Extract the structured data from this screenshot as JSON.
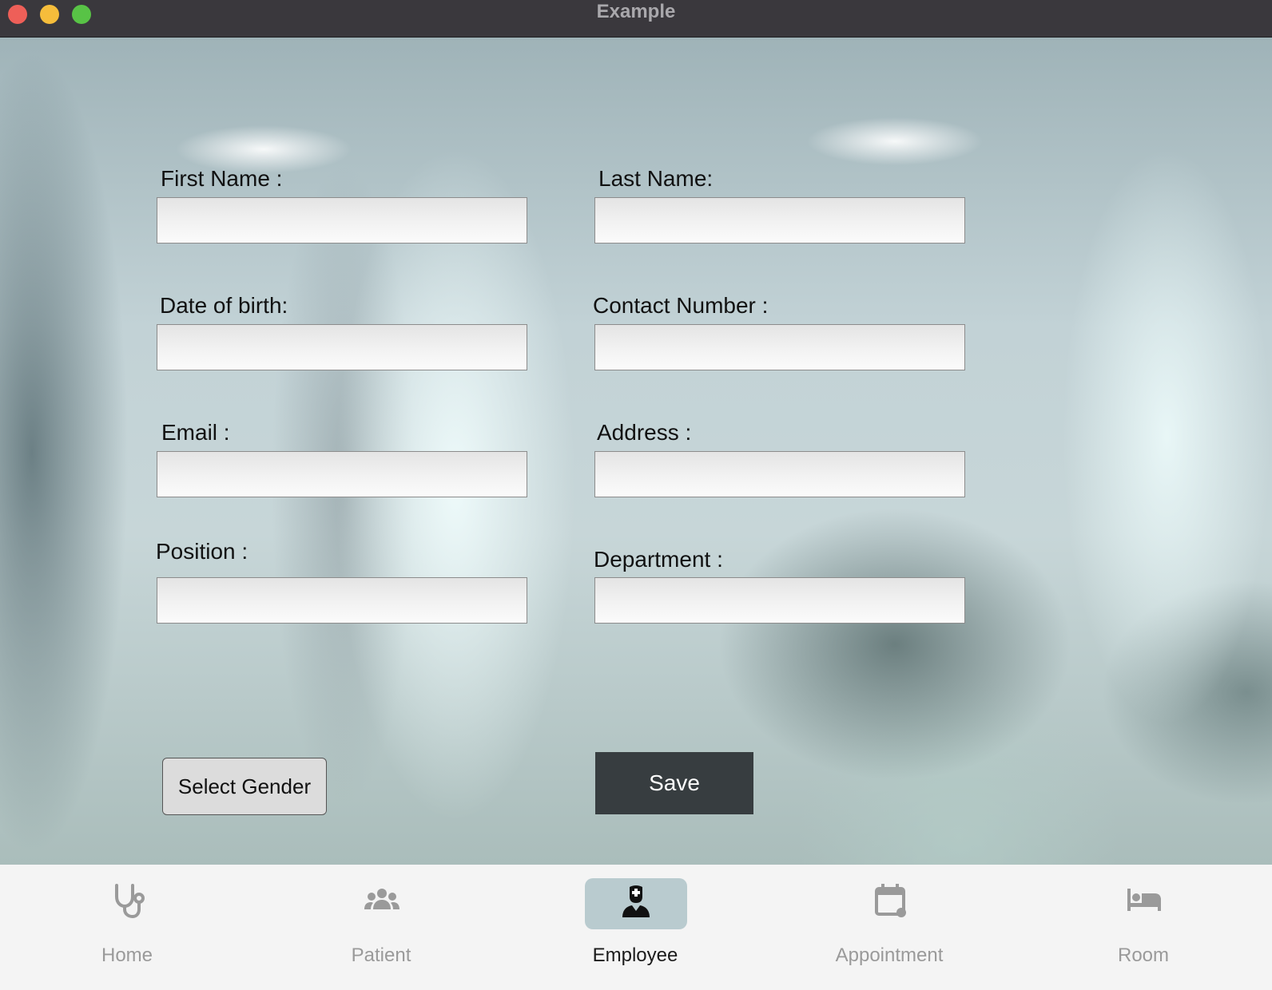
{
  "window": {
    "title": "Example"
  },
  "form": {
    "first_name": {
      "label": "First Name :",
      "value": "",
      "placeholder": ""
    },
    "last_name": {
      "label": "Last Name:",
      "value": "",
      "placeholder": ""
    },
    "date_of_birth": {
      "label": "Date of birth:",
      "value": "",
      "placeholder": ""
    },
    "contact_number": {
      "label": "Contact Number :",
      "value": "",
      "placeholder": ""
    },
    "email": {
      "label": "Email :",
      "value": "",
      "placeholder": ""
    },
    "address": {
      "label": "Address :",
      "value": "",
      "placeholder": ""
    },
    "position": {
      "label": "Position :",
      "value": "",
      "placeholder": ""
    },
    "department": {
      "label": "Department :",
      "value": "",
      "placeholder": ""
    },
    "select_gender_label": "Select Gender",
    "save_label": "Save"
  },
  "nav": {
    "active": "Employee",
    "items": [
      {
        "label": "Home",
        "icon": "stethoscope-icon"
      },
      {
        "label": "Patient",
        "icon": "group-icon"
      },
      {
        "label": "Employee",
        "icon": "doctor-icon"
      },
      {
        "label": "Appointment",
        "icon": "calendar-icon"
      },
      {
        "label": "Room",
        "icon": "bed-icon"
      }
    ]
  },
  "colors": {
    "titlebar": "#3a383d",
    "save_button": "#373d40",
    "nav_active_pill": "#b9cbcf",
    "nav_inactive": "#9a9a9a"
  }
}
